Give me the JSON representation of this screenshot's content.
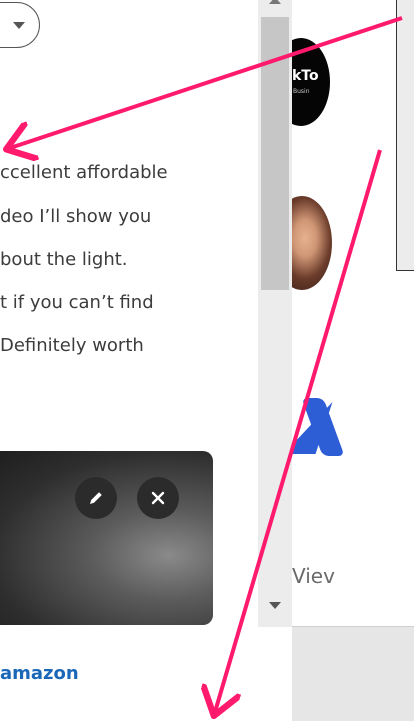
{
  "description": {
    "lines": [
      "ccellent affordable",
      "deo I’ll show you",
      "bout the light.",
      "t if you can’t find",
      "Definitely worth"
    ]
  },
  "video_card": {
    "edit_icon": "pencil-icon",
    "close_icon": "close-icon"
  },
  "link": {
    "amazon_text": "amazon"
  },
  "sidebar": {
    "tiktok_logo_text": "kTo",
    "tiktok_logo_sub": "Busin",
    "view_text": "Viev"
  },
  "colors": {
    "arrow": "#ff1a6e",
    "link": "#1a67b8"
  }
}
